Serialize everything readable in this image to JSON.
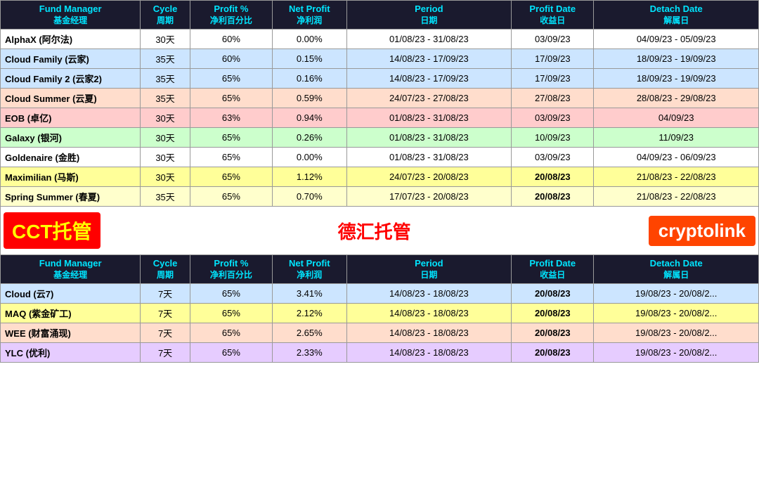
{
  "colors": {
    "header_bg": "#1a1a2e",
    "header_text": "#00e5ff"
  },
  "table1": {
    "headers": [
      {
        "label": "Fund Manager",
        "sub": "基金经理"
      },
      {
        "label": "Cycle",
        "sub": "周期"
      },
      {
        "label": "Profit %",
        "sub": "净利百分比"
      },
      {
        "label": "Net Profit",
        "sub": "净利润"
      },
      {
        "label": "Period",
        "sub": "日期"
      },
      {
        "label": "Profit Date",
        "sub": "收益日"
      },
      {
        "label": "Detach Date",
        "sub": "解属日"
      }
    ],
    "rows": [
      {
        "manager": "AlphaX (阿尔法)",
        "cycle": "30天",
        "profit_pct": "60%",
        "net_profit": "0.00%",
        "period": "01/08/23 - 31/08/23",
        "profit_date": "03/09/23",
        "detach_date": "04/09/23 - 05/09/23",
        "row_class": "row-white"
      },
      {
        "manager": "Cloud Family (云家)",
        "cycle": "35天",
        "profit_pct": "60%",
        "net_profit": "0.15%",
        "period": "14/08/23 - 17/09/23",
        "profit_date": "17/09/23",
        "detach_date": "18/09/23 - 19/09/23",
        "row_class": "row-light-blue"
      },
      {
        "manager": "Cloud Family 2 (云家2)",
        "cycle": "35天",
        "profit_pct": "65%",
        "net_profit": "0.16%",
        "period": "14/08/23 - 17/09/23",
        "profit_date": "17/09/23",
        "detach_date": "18/09/23 - 19/09/23",
        "row_class": "row-light-blue"
      },
      {
        "manager": "Cloud Summer (云夏)",
        "cycle": "35天",
        "profit_pct": "65%",
        "net_profit": "0.59%",
        "period": "24/07/23 - 27/08/23",
        "profit_date": "27/08/23",
        "detach_date": "28/08/23 - 29/08/23",
        "row_class": "row-peach"
      },
      {
        "manager": "EOB (卓亿)",
        "cycle": "30天",
        "profit_pct": "63%",
        "net_profit": "0.94%",
        "period": "01/08/23 - 31/08/23",
        "profit_date": "03/09/23",
        "detach_date": "04/09/23",
        "row_class": "row-pink"
      },
      {
        "manager": "Galaxy (银河)",
        "cycle": "30天",
        "profit_pct": "65%",
        "net_profit": "0.26%",
        "period": "01/08/23 - 31/08/23",
        "profit_date": "10/09/23",
        "detach_date": "11/09/23",
        "row_class": "row-light-green"
      },
      {
        "manager": "Goldenaire (金胜)",
        "cycle": "30天",
        "profit_pct": "65%",
        "net_profit": "0.00%",
        "period": "01/08/23 - 31/08/23",
        "profit_date": "03/09/23",
        "detach_date": "04/09/23 - 06/09/23",
        "row_class": "row-white"
      },
      {
        "manager": "Maximilian (马斯)",
        "cycle": "30天",
        "profit_pct": "65%",
        "net_profit": "1.12%",
        "period": "24/07/23 - 20/08/23",
        "profit_date": "20/08/23",
        "detach_date": "21/08/23 - 22/08/23",
        "row_class": "row-yellow",
        "bold_date": true
      },
      {
        "manager": "Spring Summer (春夏)",
        "cycle": "35天",
        "profit_pct": "65%",
        "net_profit": "0.70%",
        "period": "17/07/23 - 20/08/23",
        "profit_date": "20/08/23",
        "detach_date": "21/08/23 - 22/08/23",
        "row_class": "row-light-yellow",
        "bold_date": true
      }
    ]
  },
  "middle": {
    "cct": "CCT托管",
    "dehui": "德汇托管",
    "cryptolink": "cryptolink"
  },
  "table2": {
    "headers": [
      {
        "label": "Fund Manager",
        "sub": "基金经理"
      },
      {
        "label": "Cycle",
        "sub": "周期"
      },
      {
        "label": "Profit %",
        "sub": "净利百分比"
      },
      {
        "label": "Net Profit",
        "sub": "净利润"
      },
      {
        "label": "Period",
        "sub": "日期"
      },
      {
        "label": "Profit Date",
        "sub": "收益日"
      },
      {
        "label": "Detach Date",
        "sub": "解属日"
      }
    ],
    "rows": [
      {
        "manager": "Cloud (云7)",
        "cycle": "7天",
        "profit_pct": "65%",
        "net_profit": "3.41%",
        "period": "14/08/23 - 18/08/23",
        "profit_date": "20/08/23",
        "detach_date": "19/08/23 - 20/08/2...",
        "row_class": "row-light-blue",
        "bold_date": true
      },
      {
        "manager": "MAQ (紫金矿工)",
        "cycle": "7天",
        "profit_pct": "65%",
        "net_profit": "2.12%",
        "period": "14/08/23 - 18/08/23",
        "profit_date": "20/08/23",
        "detach_date": "19/08/23 - 20/08/2...",
        "row_class": "row-yellow",
        "bold_date": true
      },
      {
        "manager": "WEE (财富涌现)",
        "cycle": "7天",
        "profit_pct": "65%",
        "net_profit": "2.65%",
        "period": "14/08/23 - 18/08/23",
        "profit_date": "20/08/23",
        "detach_date": "19/08/23 - 20/08/2...",
        "row_class": "row-peach",
        "bold_date": true
      },
      {
        "manager": "YLC (优利)",
        "cycle": "7天",
        "profit_pct": "65%",
        "net_profit": "2.33%",
        "period": "14/08/23 - 18/08/23",
        "profit_date": "20/08/23",
        "detach_date": "19/08/23 - 20/08/2...",
        "row_class": "row-lavender",
        "bold_date": true
      }
    ]
  }
}
